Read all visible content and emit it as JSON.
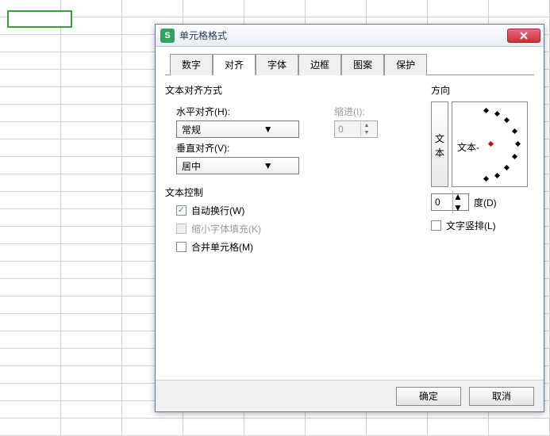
{
  "dialog": {
    "title": "单元格格式",
    "tabs": [
      "数字",
      "对齐",
      "字体",
      "边框",
      "图案",
      "保护"
    ],
    "active_tab": "对齐"
  },
  "align": {
    "group_label": "文本对齐方式",
    "h_label": "水平对齐(H):",
    "h_value": "常规",
    "indent_label": "缩进(I):",
    "indent_value": "0",
    "v_label": "垂直对齐(V):",
    "v_value": "居中"
  },
  "control": {
    "group_label": "文本控制",
    "wrap": "自动换行(W)",
    "shrink": "缩小字体填充(K)",
    "merge": "合并单元格(M)"
  },
  "direction": {
    "group_label": "方向",
    "vertical_btn_top": "文",
    "vertical_btn_bottom": "本",
    "arc_label": "文本",
    "degree_value": "0",
    "degree_label": "度(D)",
    "vertical_text": "文字竖排(L)"
  },
  "buttons": {
    "ok": "确定",
    "cancel": "取消"
  }
}
